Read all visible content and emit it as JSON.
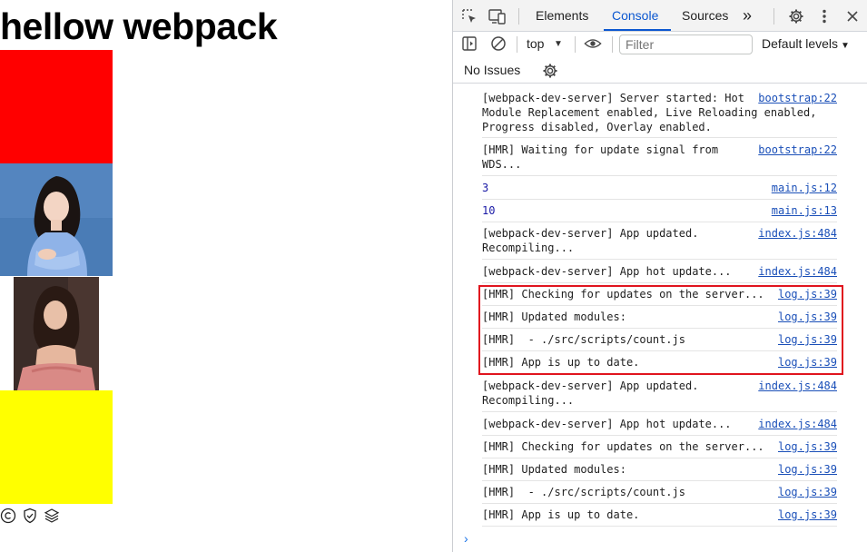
{
  "page": {
    "title": "hellow webpack",
    "box_colors": {
      "red": "#ff0000",
      "yellow": "#ffff00"
    },
    "images": [
      "photo-woman-blue-dress",
      "photo-woman-pink-dress"
    ],
    "footer_icons": [
      "copyright-icon",
      "shield-check-icon",
      "layers-icon"
    ]
  },
  "devtools": {
    "tabs": [
      "Elements",
      "Console",
      "Sources"
    ],
    "active_tab": "Console",
    "more_tabs_glyph": "»",
    "toolbar": {
      "context": "top",
      "filter_placeholder": "Filter",
      "levels": "Default levels"
    },
    "issues": "No Issues",
    "messages": [
      {
        "text": "[webpack-dev-server] Server started: Hot\nModule Replacement enabled, Live Reloading enabled,\nProgress disabled, Overlay enabled.",
        "source": "bootstrap:22"
      },
      {
        "text": "[HMR] Waiting for update signal from\nWDS...",
        "source": "bootstrap:22"
      },
      {
        "text": "3",
        "source": "main.js:12"
      },
      {
        "text": "10",
        "source": "main.js:13"
      },
      {
        "text": "[webpack-dev-server] App updated.\nRecompiling...",
        "source": "index.js:484"
      },
      {
        "text": "[webpack-dev-server] App hot update...",
        "source": "index.js:484"
      },
      {
        "text": "[HMR] Checking for updates on the server...",
        "source": "log.js:39"
      },
      {
        "text": "[HMR] Updated modules:",
        "source": "log.js:39"
      },
      {
        "text": "[HMR]  - ./src/scripts/count.js",
        "source": "log.js:39"
      },
      {
        "text": "[HMR] App is up to date.",
        "source": "log.js:39"
      },
      {
        "text": "[webpack-dev-server] App updated.\nRecompiling...",
        "source": "index.js:484"
      },
      {
        "text": "[webpack-dev-server] App hot update...",
        "source": "index.js:484"
      },
      {
        "text": "[HMR] Checking for updates on the server...",
        "source": "log.js:39"
      },
      {
        "text": "[HMR] Updated modules:",
        "source": "log.js:39"
      },
      {
        "text": "[HMR]  - ./src/scripts/count.js",
        "source": "log.js:39"
      },
      {
        "text": "[HMR] App is up to date.",
        "source": "log.js:39"
      }
    ],
    "prompt_glyph": "›",
    "highlight_color": "#e0141e"
  }
}
